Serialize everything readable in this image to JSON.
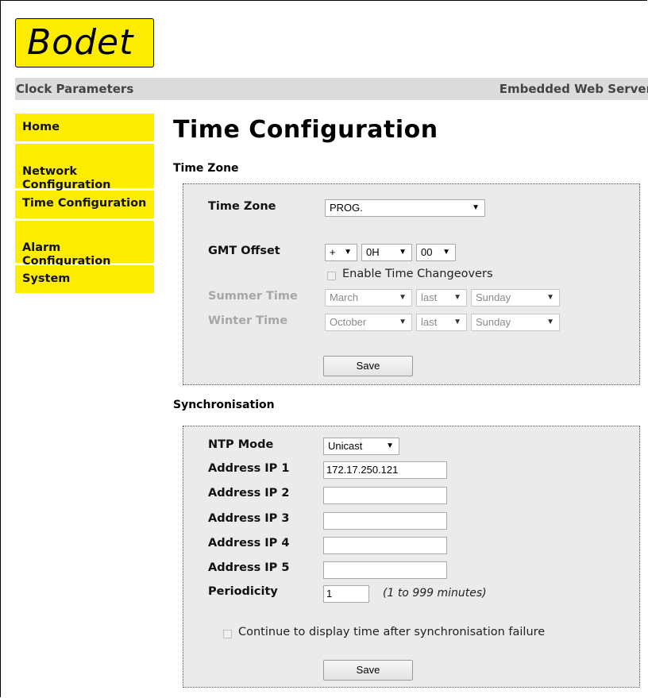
{
  "logo": {
    "text": "Bodet"
  },
  "header": {
    "left": "Clock Parameters",
    "right": "Embedded Web Server"
  },
  "nav": {
    "items": [
      {
        "label": "Home"
      },
      {
        "label": "Network\nConfiguration"
      },
      {
        "label": "Time Configuration"
      },
      {
        "label": "Alarm\nConfiguration"
      },
      {
        "label": "System"
      }
    ]
  },
  "page_title": "Time Configuration",
  "time_zone_section": {
    "title": "Time Zone",
    "time_zone_label": "Time Zone",
    "time_zone_value": "PROG.",
    "gmt_offset_label": "GMT Offset",
    "gmt_sign": "+",
    "gmt_hours": "0H",
    "gmt_minutes": "00",
    "enable_changeovers_label": "Enable Time Changeovers",
    "summer_label": "Summer Time",
    "summer_month": "March",
    "summer_week": "last",
    "summer_day": "Sunday",
    "winter_label": "Winter Time",
    "winter_month": "October",
    "winter_week": "last",
    "winter_day": "Sunday",
    "save_label": "Save"
  },
  "sync_section": {
    "title": "Synchronisation",
    "ntp_mode_label": "NTP Mode",
    "ntp_mode_value": "Unicast",
    "ip1_label": "Address IP 1",
    "ip1_value": "172.17.250.121",
    "ip2_label": "Address IP 2",
    "ip2_value": "",
    "ip3_label": "Address IP 3",
    "ip3_value": "",
    "ip4_label": "Address IP 4",
    "ip4_value": "",
    "ip5_label": "Address IP 5",
    "ip5_value": "",
    "periodicity_label": "Periodicity",
    "periodicity_value": "1",
    "periodicity_hint": "(1 to 999 minutes)",
    "continue_label": "Continue to display time after synchronisation failure",
    "save_label": "Save"
  },
  "colors": {
    "brand_yellow": "#ffed00",
    "header_gray": "#dcdcdc",
    "panel_gray": "#ebebeb"
  }
}
